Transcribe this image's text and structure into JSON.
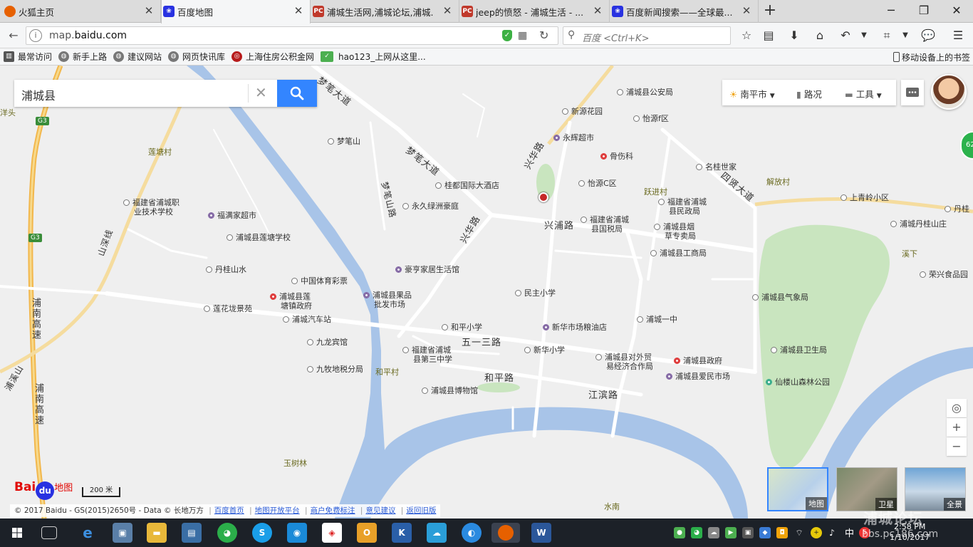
{
  "browser": {
    "tabs": [
      {
        "label": "火狐主页",
        "icon": "firefox-icon"
      },
      {
        "label": "百度地图",
        "icon": "baidu-paw-icon"
      },
      {
        "label": "浦城生活网,浦城论坛,浦城...",
        "icon": "pc-icon"
      },
      {
        "label": "jeep的愤怒 - 浦城生活 - ...",
        "icon": "pc-icon"
      },
      {
        "label": "百度新闻搜索——全球最...",
        "icon": "baidu-paw-icon"
      }
    ],
    "url_host": "map.baidu.com",
    "url_prefix": "map.",
    "url_domain": "baidu.com",
    "search_placeholder": "百度 <Ctrl+K>",
    "bookmarks": [
      {
        "label": "最常访问"
      },
      {
        "label": "新手上路"
      },
      {
        "label": "建议网站"
      },
      {
        "label": "网页快讯库"
      },
      {
        "label": "上海住房公积金网"
      },
      {
        "label": "hao123_上网从这里..."
      }
    ],
    "mobile_bookmarks": "移动设备上的书签"
  },
  "map": {
    "search_value": "浦城县",
    "city": "南平市",
    "traffic": "路况",
    "tools": "工具",
    "badge": "62",
    "scale_label": "200 米",
    "logo_text": "Bai",
    "logo_du": "du",
    "logo_map": "地图",
    "thumbs": [
      {
        "label": "地图"
      },
      {
        "label": "卫星"
      },
      {
        "label": "全景"
      }
    ],
    "footer": {
      "copyright": "© 2017 Baidu - GS(2015)2650号 - Data © 长地万方",
      "links": [
        "百度首页",
        "地图开放平台",
        "商户免费标注",
        "意见建议",
        "返回旧版"
      ]
    },
    "roads": {
      "mengbi": "梦笔大道",
      "mengbi2": "梦笔大道",
      "xinghua": "兴华路",
      "xinghua2": "兴华路",
      "xingpu": "兴浦路",
      "siyan": "四贤大道",
      "wuyisan": "五一三路",
      "heping": "和平路",
      "jiangbin": "江滨路",
      "mengbishan": "梦笔山路",
      "shanshen": "山深线",
      "punan1": "浦南高速",
      "punan2": "浦南高速",
      "shanxi": "浦溪山",
      "g3a": "G3",
      "g3b": "G3"
    },
    "villages": {
      "liantang": "莲塘村",
      "yueji": "跃进村",
      "jiefang": "解放村",
      "xixia": "溪下",
      "hepingcun": "和平村",
      "yushulin": "玉树林",
      "shuinan": "水南",
      "yangtou": "洋头"
    },
    "pois": {
      "gonganju": "浦城县公安局",
      "xinyuan": "新源花园",
      "yiyuanf": "怡源f区",
      "yonghui": "永辉超市",
      "gushang": "骨伤科",
      "mingui": "名桂世家",
      "mengbishan": "梦笔山",
      "guidu": "桂都国际大酒店",
      "yiyuanc": "怡源C区",
      "minzheng1": "福建省浦城",
      "minzheng2": "县民政局",
      "shangqingling": "上青岭小区",
      "dangui": "丹桂",
      "zhiye1": "福建省浦城职",
      "zhiye2": "业技术学校",
      "fumanjia": "福满家超市",
      "yongjiu": "永久绿洲豪庭",
      "guoshui1": "福建省浦城",
      "guoshui2": "县国税局",
      "yancao1": "浦城县烟",
      "yancao2": "草专卖局",
      "danguishanzhuang": "浦城丹桂山庄",
      "liantangxuexiao": "浦城县莲塘学校",
      "gongshang": "浦城县工商局",
      "danguishanshui": "丹桂山水",
      "haoheng": "豪亨家居生活馆",
      "rongxing": "荣兴食品园",
      "tiyucaipiao": "中国体育彩票",
      "zhenzhengfu1": "浦城县莲",
      "zhenzhengfu2": "塘镇政府",
      "guopin1": "浦城县果品",
      "guopin2": "批发市场",
      "minzhu": "民主小学",
      "qixiang": "浦城县气象局",
      "lianhualong": "莲花垅景苑",
      "qichezhan": "浦城汽车站",
      "hepingxiaoxue": "和平小学",
      "xinhualiang": "新华市场粮油店",
      "yizhong": "浦城一中",
      "jiulong": "九龙宾馆",
      "sanzhong1": "福建省浦城",
      "sanzhong2": "县第三中学",
      "xinhuaxiaoxue": "新华小学",
      "duiwai1": "浦城县对外贸",
      "duiwai2": "易经济合作局",
      "zhengfu": "浦城县政府",
      "weisheng": "浦城县卫生局",
      "jiumu": "九牧地税分局",
      "aiguo": "浦城县爱民市场",
      "xianloushan": "仙楼山森林公园",
      "bowuguan": "浦城县博物馆"
    }
  },
  "taskbar": {
    "tray_lang": "中",
    "time": "2:58 PM",
    "date": "1/10/2017"
  },
  "watermark": {
    "line1": "浦城论坛",
    "line2": "bbs.pc186.com"
  }
}
